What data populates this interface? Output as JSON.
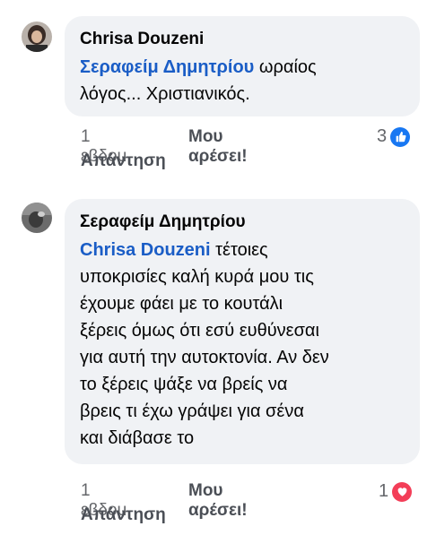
{
  "comments": [
    {
      "author": "Chrisa Douzeni",
      "mention": "Σεραφείμ Δημητρίου",
      "text": " ωραίος\nλόγος... Χριστιανικός.",
      "time": "1 εβδομ.",
      "like_label": "Μου αρέσει!",
      "reply_label": "Απάντηση",
      "reaction_count": "3",
      "reaction_icon": "like-icon",
      "reaction_color": "#1877f2"
    },
    {
      "author": "Σεραφείμ Δημητρίου",
      "mention": "Chrisa Douzeni",
      "text": " τέτοιες\nυποκρισίες καλή κυρά μου τις\nέχουμε φάει με το κουτάλι\nξέρεις όμως ότι εσύ ευθύνεσαι\nγια αυτή την αυτοκτονία. Αν δεν\nτο ξέρεις ψάξε να βρείς να\nβρεις τι έχω γράψει για σένα\nκαι διάβασε το",
      "time": "1 εβδομ.",
      "like_label": "Μου αρέσει!",
      "reply_label": "Απάντηση",
      "reaction_count": "1",
      "reaction_icon": "love-icon",
      "reaction_color": "#f33e58"
    }
  ]
}
